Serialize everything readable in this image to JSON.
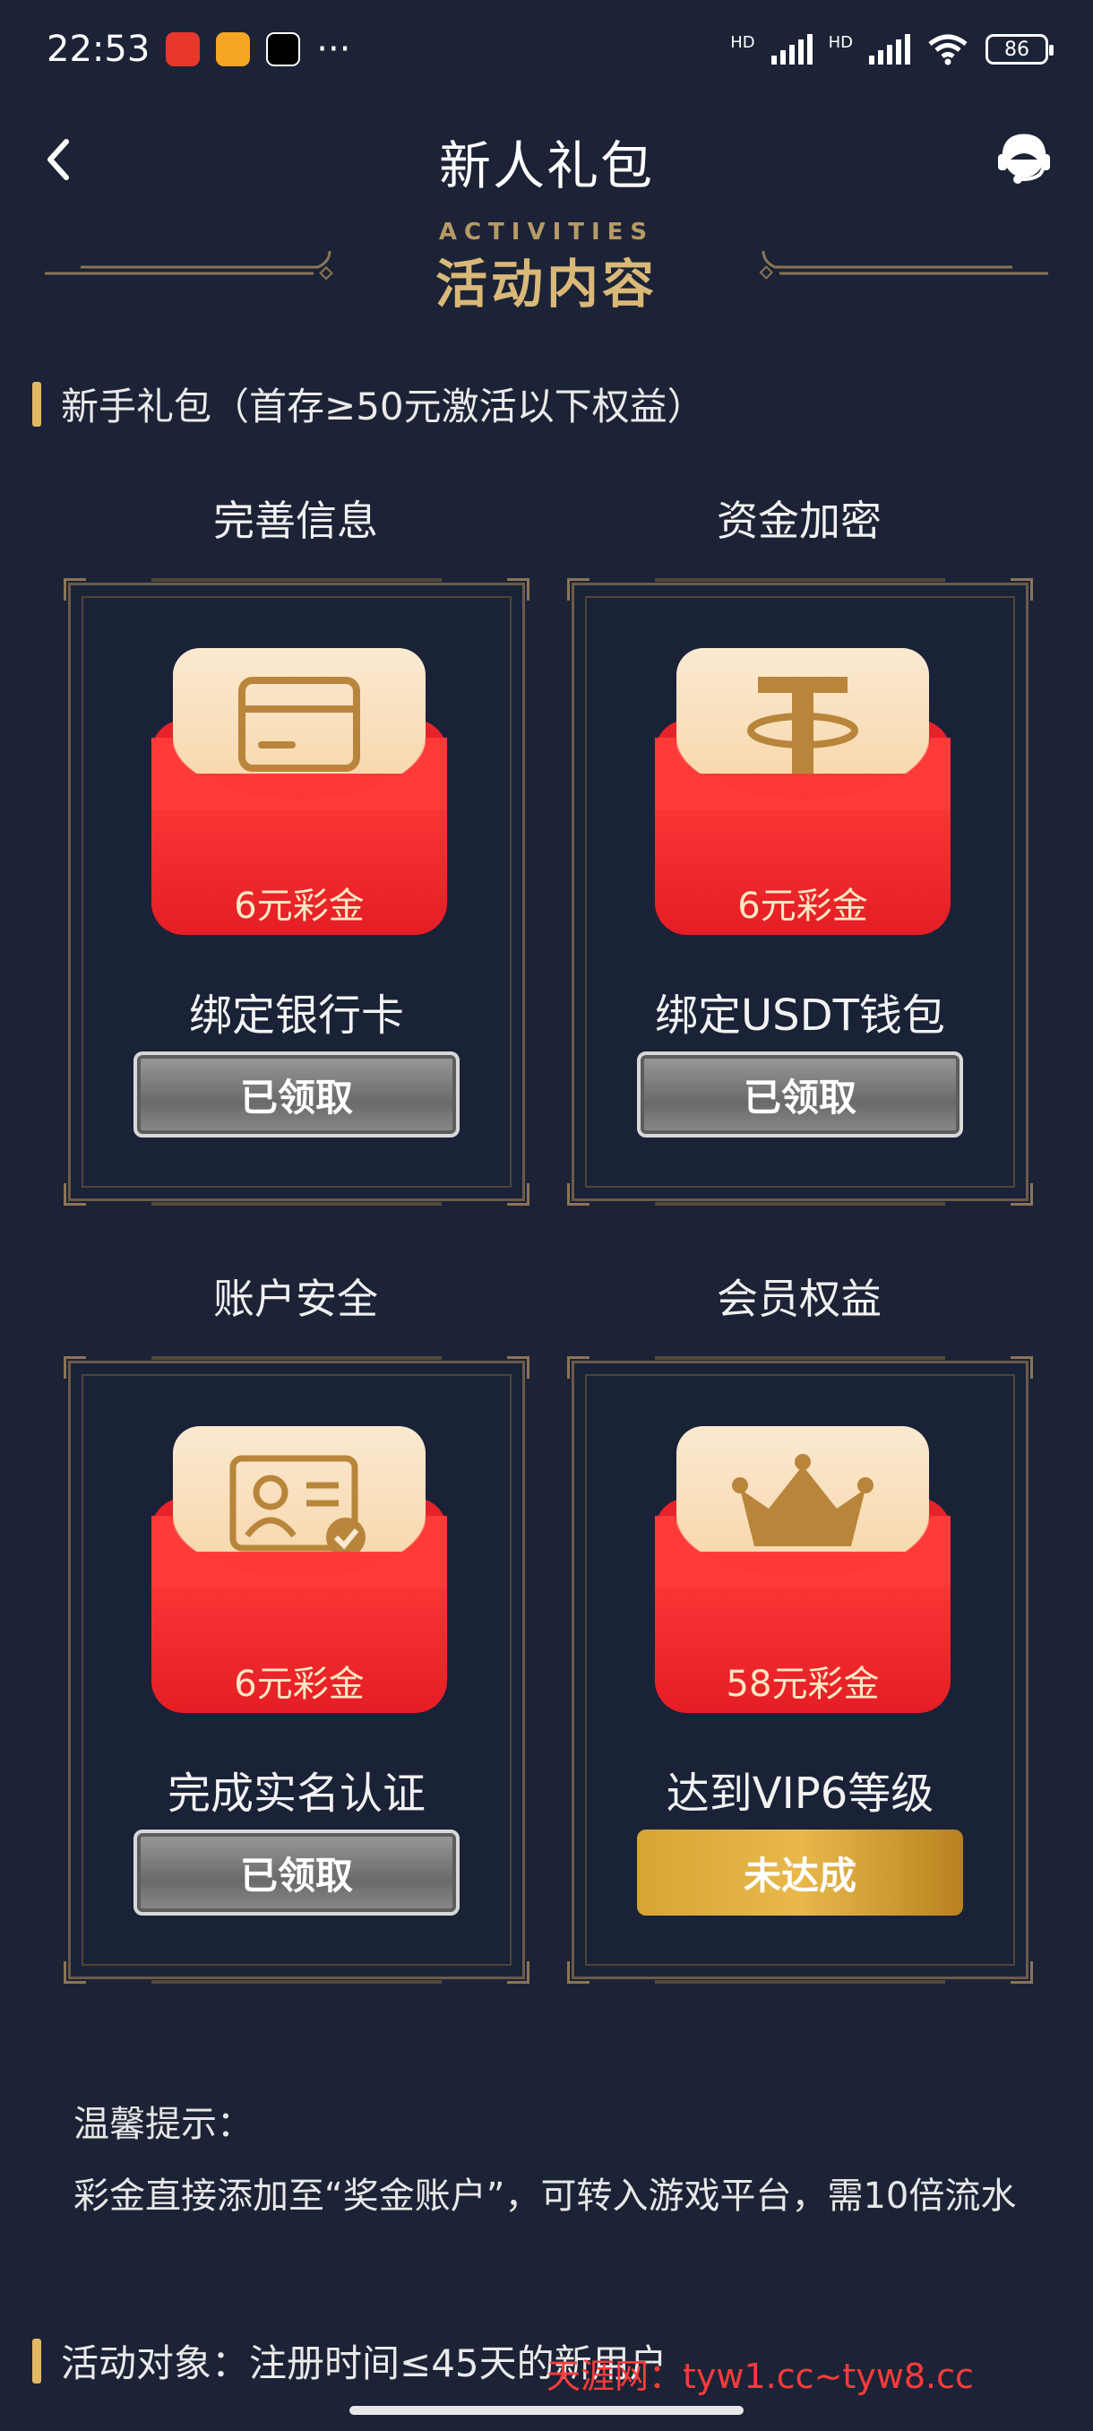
{
  "status_bar": {
    "time": "22:53",
    "dots": "···",
    "hd1": "HD",
    "hd2": "HD",
    "battery": "86"
  },
  "header": {
    "title": "新人礼包",
    "back_icon": "chevron-left-icon",
    "service_icon": "customer-service-icon"
  },
  "section": {
    "en_title": "ACTIVITIES",
    "zh_title": "活动内容"
  },
  "newbie": {
    "heading": "新手礼包（首存≥50元激活以下权益）",
    "items": [
      {
        "title": "完善信息",
        "reward": "6元彩金",
        "task": "绑定银行卡",
        "button": "已领取",
        "icon": "bank-card-icon",
        "claimed": true
      },
      {
        "title": "资金加密",
        "reward": "6元彩金",
        "task": "绑定USDT钱包",
        "button": "已领取",
        "icon": "usdt-icon",
        "claimed": true
      },
      {
        "title": "账户安全",
        "reward": "6元彩金",
        "task": "完成实名认证",
        "button": "已领取",
        "icon": "id-card-icon",
        "claimed": true
      },
      {
        "title": "会员权益",
        "reward": "58元彩金",
        "task": "达到VIP6等级",
        "button": "未达成",
        "icon": "crown-icon",
        "claimed": false
      }
    ]
  },
  "tips": {
    "label": "温馨提示：",
    "text": "彩金直接添加至“奖金账户”，可转入游戏平台，需10倍流水"
  },
  "target": {
    "heading": "活动对象：注册时间≤45天的新用户"
  },
  "watermark": "天涯网：tyw1.cc~tyw8.cc",
  "colors": {
    "background": "#1c2336",
    "accent_gold": "#e3b865",
    "envelope_red": "#e41e24",
    "button_gold": "#d7a534",
    "button_gray": "#8a8a8a"
  }
}
